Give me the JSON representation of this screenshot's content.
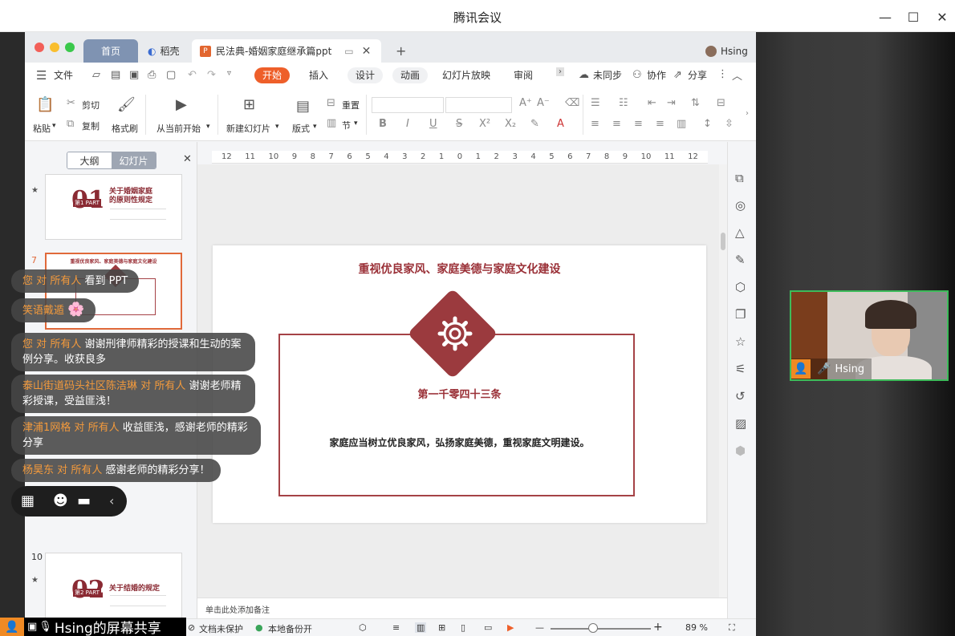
{
  "meeting": {
    "title": "腾讯会议",
    "share_label": "Hsing的屏幕共享"
  },
  "wps": {
    "tabs": {
      "home": "首页",
      "daoke": "稻壳",
      "doc": "民法典-婚姻家庭继承篇ppt"
    },
    "user": "Hsing",
    "menu": {
      "file": "文件",
      "start": "开始",
      "insert": "插入",
      "design": "设计",
      "animation": "动画",
      "slideshow": "幻灯片放映",
      "review": "审阅",
      "unsynced": "未同步",
      "collab": "协作",
      "share": "分享"
    },
    "ribbon": {
      "paste": "粘贴",
      "cut": "剪切",
      "copy": "复制",
      "format_painter": "格式刷",
      "play_from_current": "从当前开始",
      "new_slide": "新建幻灯片",
      "layout": "版式",
      "reset": "重置",
      "section": "节"
    },
    "panel": {
      "outline": "大纲",
      "slides": "幻灯片"
    },
    "thumbs": [
      {
        "num": "",
        "big": "01",
        "part": "第1 PART",
        "title": "关于婚姻家庭的原则性规定"
      },
      {
        "num": "7",
        "title": "重视优良家风、家庭美德与家庭文化建设"
      },
      {
        "num": "10",
        "big": "02",
        "part": "第2 PART",
        "title": "关于结婚的规定"
      }
    ],
    "ruler": [
      "12",
      "11",
      "10",
      "9",
      "8",
      "7",
      "6",
      "5",
      "4",
      "3",
      "2",
      "1",
      "0",
      "1",
      "2",
      "3",
      "4",
      "5",
      "6",
      "7",
      "8",
      "9",
      "10",
      "11",
      "12"
    ],
    "slide": {
      "title": "重视优良家风、家庭美德与家庭文化建设",
      "article": "第一千零四十三条",
      "text": "家庭应当树立优良家风，弘扬家庭美德，重视家庭文明建设。"
    },
    "notes_placeholder": "单击此处添加备注",
    "status": {
      "doc_unprotected": "文档未保护",
      "local_backup": "本地备份开",
      "zoom": "89 %"
    }
  },
  "chat": [
    {
      "sender": "您",
      "to": "对",
      "target": "所有人",
      "msg": "看到 PPT"
    },
    {
      "sender": "笑语戴遁",
      "to": "",
      "target": "",
      "msg": "🌸"
    },
    {
      "sender": "您",
      "to": "对",
      "target": "所有人",
      "msg": "谢谢刑律师精彩的授课和生动的案例分享。收获良多"
    },
    {
      "sender": "泰山街道码头社区陈洁琳",
      "to": "对",
      "target": "所有人",
      "msg": "谢谢老师精彩授课，受益匪浅！"
    },
    {
      "sender": "津浦1网格",
      "to": "对",
      "target": "所有人",
      "msg": "收益匪浅，感谢老师的精彩分享"
    },
    {
      "sender": "杨昊东",
      "to": "对",
      "target": "所有人",
      "msg": "感谢老师的精彩分享！"
    }
  ],
  "participant": {
    "name": "Hsing"
  },
  "colors": {
    "accent": "#ee5f2a",
    "slide_red": "#9b3a3e",
    "speaking": "#3dbb5a"
  }
}
